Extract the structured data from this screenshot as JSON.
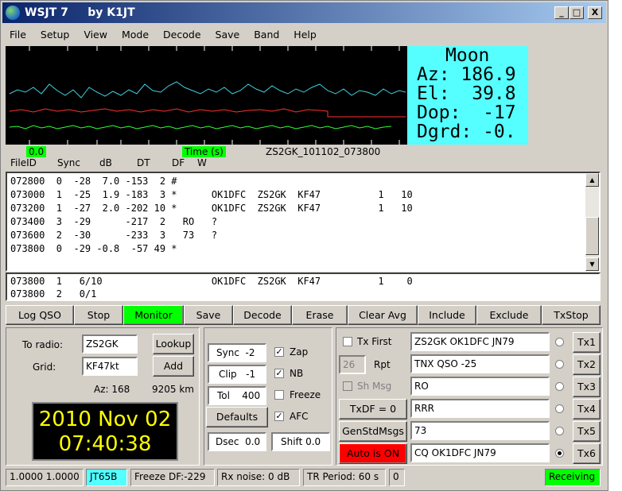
{
  "window": {
    "title": "WSJT 7     by K1JT",
    "minimize": "_",
    "maximize": "□",
    "close": "X"
  },
  "menu": [
    "File",
    "Setup",
    "View",
    "Mode",
    "Decode",
    "Save",
    "Band",
    "Help"
  ],
  "moon": {
    "title": "Moon",
    "lines": [
      "Az: 186.9",
      "El:  39.8",
      "Dop:  -17",
      "Dgrd: -0."
    ]
  },
  "waterfall_labels": {
    "left": "0.0",
    "mid": "Time (s)",
    "file": "ZS2GK_101102_073800"
  },
  "col_headers": [
    "FileID",
    "Sync",
    "dB",
    "DT",
    "DF",
    "W"
  ],
  "decode_lines": [
    "072800  0  -28  7.0 -153  2 #",
    "073000  1  -25  1.9 -183  3 *      OK1DFC  ZS2GK  KF47          1   10",
    "073200  1  -27  2.0 -202 10 *      OK1DFC  ZS2GK  KF47          1   10",
    "073400  3  -29      -217  2   RO   ?",
    "073600  2  -30      -233  3   73   ?",
    "073800  0  -29 -0.8  -57 49 *"
  ],
  "avg_lines": [
    "073800  1   6/10                   OK1DFC  ZS2GK  KF47          1    0",
    "073800  2   0/1"
  ],
  "buttons": [
    "Log QSO",
    "Stop",
    "Monitor",
    "Save",
    "Decode",
    "Erase",
    "Clear Avg",
    "Include",
    "Exclude",
    "TxStop"
  ],
  "station": {
    "to_radio_label": "To radio:",
    "to_radio": "ZS2GK",
    "grid_label": "Grid:",
    "grid": "KF47kt",
    "lookup": "Lookup",
    "add": "Add",
    "az": "Az: 168",
    "dist": "9205 km"
  },
  "clock": {
    "date": "2010 Nov 02",
    "time": "07:40:38"
  },
  "controls": {
    "sync": "Sync  -2",
    "clip": "Clip   -1",
    "tol": "Tol    400",
    "defaults": "Defaults",
    "dsec": "Dsec  0.0",
    "shift": "Shift 0.0",
    "zap": "Zap",
    "nb": "NB",
    "freeze": "Freeze",
    "afc": "AFC"
  },
  "tx": {
    "tx_first": "Tx First",
    "rpt_value": "26",
    "rpt_label": "Rpt",
    "sh_msg": "Sh Msg",
    "txdf": "TxDF = 0",
    "genstd": "GenStdMsgs",
    "auto": "Auto is ON",
    "messages": [
      "ZS2GK OK1DFC JN79",
      "TNX QSO -25",
      "RO",
      "RRR",
      "73",
      "CQ OK1DFC JN79"
    ],
    "tx_labels": [
      "Tx1",
      "Tx2",
      "Tx3",
      "Tx4",
      "Tx5",
      "Tx6"
    ]
  },
  "status": {
    "values": "1.0000 1.0000",
    "mode": "JT65B",
    "freeze": "Freeze DF:-229",
    "rx": "Rx noise:  0 dB",
    "tr": "TR Period: 60 s",
    "n": "0",
    "state": "Receiving"
  },
  "colors": {
    "monitor": "#00ff00",
    "auto": "#ff0000",
    "mode": "#55ffff",
    "receiving": "#00ff00"
  }
}
